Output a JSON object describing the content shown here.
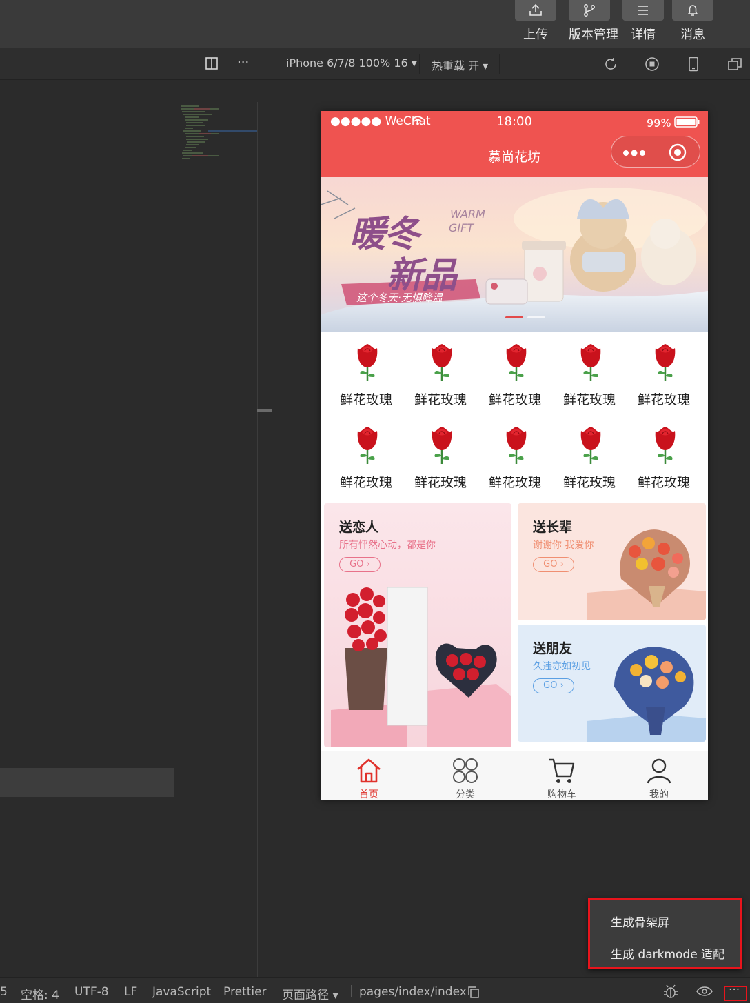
{
  "toolbar": {
    "buttons": [
      {
        "label": "上传",
        "icon": "upload-icon"
      },
      {
        "label": "版本管理",
        "icon": "branch-icon"
      },
      {
        "label": "详情",
        "icon": "menu-lines-icon"
      },
      {
        "label": "消息",
        "icon": "bell-icon"
      }
    ]
  },
  "editor": {
    "more": "···"
  },
  "simulator": {
    "device": "iPhone 6/7/8 100% 16 ▾",
    "hot_reload": "热重载 开 ▾"
  },
  "phone": {
    "carrier": "●●●●● WeChat",
    "time": "18:00",
    "battery": "99%",
    "title": "慕尚花坊",
    "banner": {
      "headline1": "暖冬",
      "headline2": "新品",
      "en1": "WARM",
      "en2": "GIFT",
      "tagline": "这个冬天·无惧降温"
    },
    "categories": [
      "鲜花玫瑰",
      "鲜花玫瑰",
      "鲜花玫瑰",
      "鲜花玫瑰",
      "鲜花玫瑰",
      "鲜花玫瑰",
      "鲜花玫瑰",
      "鲜花玫瑰",
      "鲜花玫瑰",
      "鲜花玫瑰"
    ],
    "cards": [
      {
        "title": "送恋人",
        "subtitle": "所有怦然心动，都是你",
        "go": "GO ›"
      },
      {
        "title": "送长辈",
        "subtitle": "谢谢你 我爱你",
        "go": "GO ›"
      },
      {
        "title": "送朋友",
        "subtitle": "久违亦如初见",
        "go": "GO ›"
      }
    ],
    "tabs": [
      {
        "label": "首页",
        "icon": "home-icon",
        "active": true
      },
      {
        "label": "分类",
        "icon": "category-icon",
        "active": false
      },
      {
        "label": "购物车",
        "icon": "cart-icon",
        "active": false
      },
      {
        "label": "我的",
        "icon": "user-icon",
        "active": false
      }
    ]
  },
  "popup_menu": {
    "items": [
      "生成骨架屏",
      "生成 darkmode 适配"
    ]
  },
  "statusbar": {
    "line_col": "5",
    "spaces": "空格: 4",
    "encoding": "UTF-8",
    "eol": "LF",
    "language": "JavaScript",
    "formatter": "Prettier",
    "page_path_label": "页面路径 ▾",
    "page_path": "pages/index/index",
    "more": "···"
  },
  "colors": {
    "accent_red": "#ef5350",
    "highlight_red": "#e8141c",
    "ide_background": "#2b2b2b"
  }
}
